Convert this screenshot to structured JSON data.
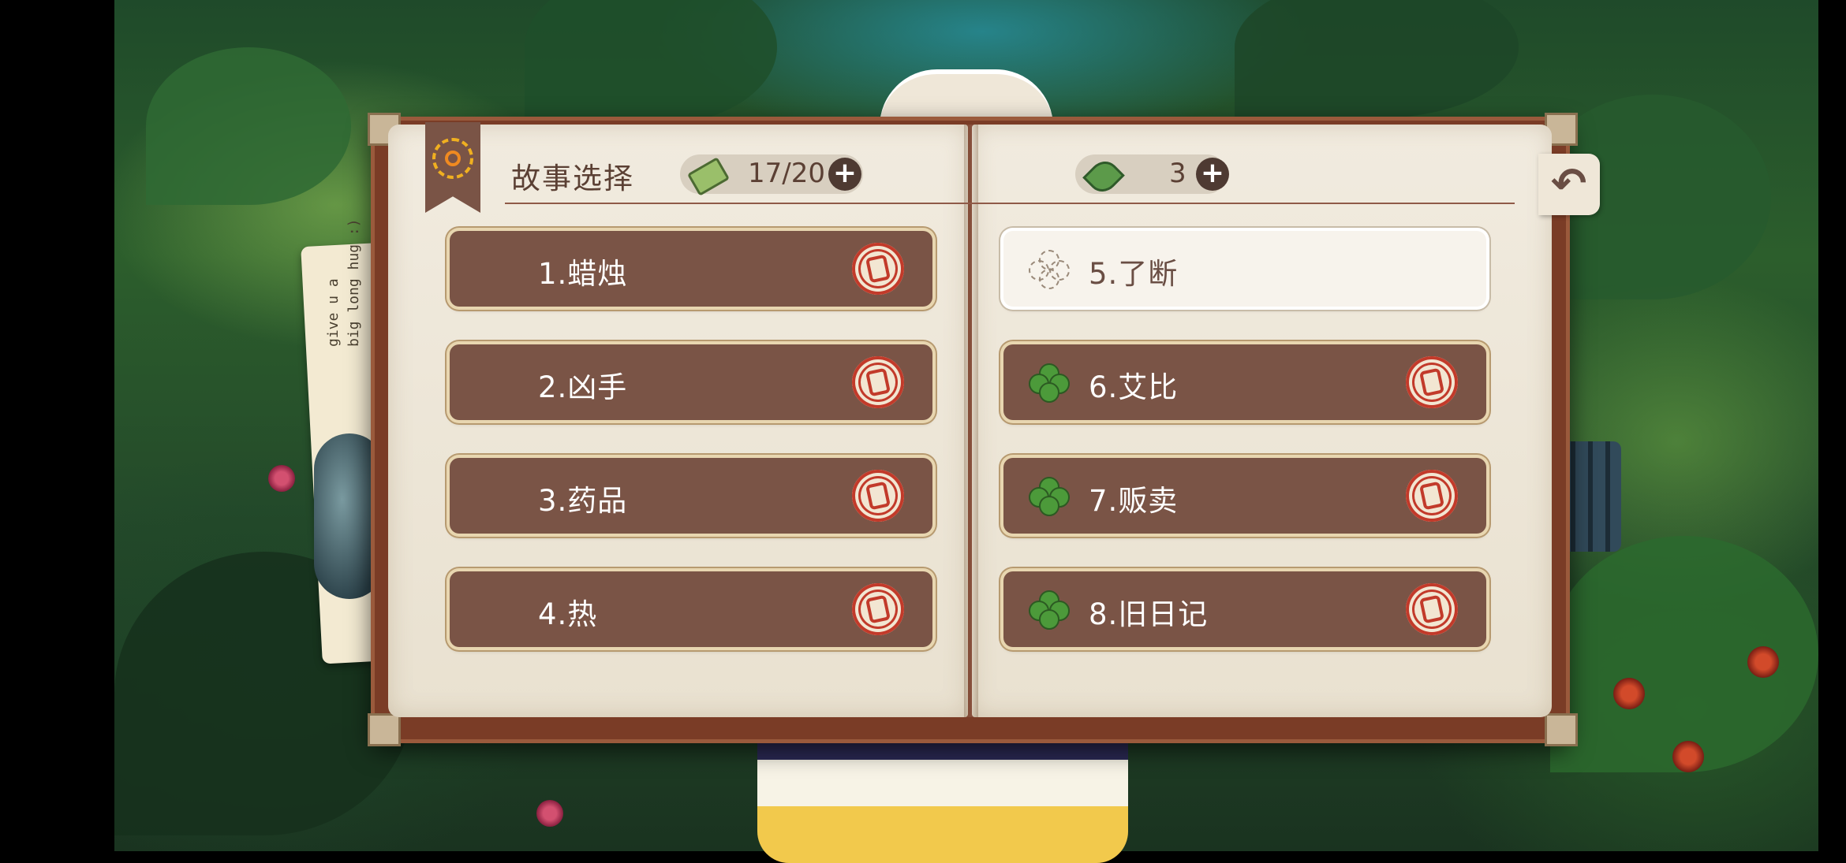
{
  "header": {
    "title": "故事选择",
    "tickets": {
      "icon": "ticket-icon",
      "value": "17/20",
      "add_label": "+"
    },
    "leaves": {
      "icon": "leaf-icon",
      "value": "3",
      "add_label": "+"
    }
  },
  "back_button": {
    "icon": "back-arrow-icon",
    "label": "↶"
  },
  "note": {
    "text": "give u a\nbig long hug :)"
  },
  "stories_left": [
    {
      "label": "1.蜡烛",
      "badge": "stamp-icon"
    },
    {
      "label": "2.凶手",
      "badge": "stamp-icon"
    },
    {
      "label": "3.药品",
      "badge": "stamp-icon"
    },
    {
      "label": "4.热",
      "badge": "stamp-icon"
    }
  ],
  "stories_right": [
    {
      "label": "5.了断",
      "badge": "clover-outline-icon",
      "selected": true
    },
    {
      "label": "6.艾比",
      "badge": "clover-icon"
    },
    {
      "label": "7.贩卖",
      "badge": "clover-icon"
    },
    {
      "label": "8.旧日记",
      "badge": "clover-icon"
    }
  ],
  "colors": {
    "card_brown": "#7a5446",
    "page_cream": "#f1ebdf",
    "stamp_red": "#c23a2a",
    "clover_green": "#4c9a3a"
  }
}
